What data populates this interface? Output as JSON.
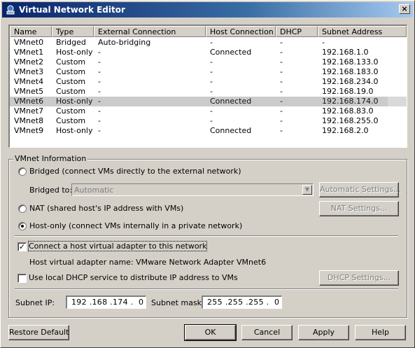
{
  "window": {
    "title": "Virtual Network Editor",
    "close_glyph": "×"
  },
  "list": {
    "columns": [
      "Name",
      "Type",
      "External Connection",
      "Host Connection",
      "DHCP",
      "Subnet Address"
    ],
    "rows": [
      {
        "name": "VMnet0",
        "type": "Bridged",
        "external": "Auto-bridging",
        "host": "-",
        "dhcp": "-",
        "subnet": "-"
      },
      {
        "name": "VMnet1",
        "type": "Host-only",
        "external": "-",
        "host": "Connected",
        "dhcp": "-",
        "subnet": "192.168.1.0"
      },
      {
        "name": "VMnet2",
        "type": "Custom",
        "external": "-",
        "host": "-",
        "dhcp": "-",
        "subnet": "192.168.133.0"
      },
      {
        "name": "VMnet3",
        "type": "Custom",
        "external": "-",
        "host": "-",
        "dhcp": "-",
        "subnet": "192.168.183.0"
      },
      {
        "name": "VMnet4",
        "type": "Custom",
        "external": "-",
        "host": "-",
        "dhcp": "-",
        "subnet": "192.168.234.0"
      },
      {
        "name": "VMnet5",
        "type": "Custom",
        "external": "-",
        "host": "-",
        "dhcp": "-",
        "subnet": "192.168.19.0"
      },
      {
        "name": "VMnet6",
        "type": "Host-only",
        "external": "-",
        "host": "Connected",
        "dhcp": "-",
        "subnet": "192.168.174.0"
      },
      {
        "name": "VMnet7",
        "type": "Custom",
        "external": "-",
        "host": "-",
        "dhcp": "-",
        "subnet": "192.168.83.0"
      },
      {
        "name": "VMnet8",
        "type": "Custom",
        "external": "-",
        "host": "-",
        "dhcp": "-",
        "subnet": "192.168.255.0"
      },
      {
        "name": "VMnet9",
        "type": "Host-only",
        "external": "-",
        "host": "Connected",
        "dhcp": "-",
        "subnet": "192.168.2.0"
      }
    ],
    "selected_index": 6
  },
  "info": {
    "group_label": "VMnet Information",
    "bridged_label": "Bridged (connect VMs directly to the external network)",
    "bridged_to_label": "Bridged to:",
    "bridged_to_value": "Automatic",
    "automatic_settings_button": "Automatic Settings...",
    "nat_label": "NAT (shared host's IP address with VMs)",
    "nat_settings_button": "NAT Settings...",
    "hostonly_label": "Host-only (connect VMs internally in a private network)",
    "selected_mode": "host-only",
    "connect_adapter_label": "Connect a host virtual adapter to this network",
    "connect_adapter_checked": true,
    "adapter_name_label": "Host virtual adapter name: VMware Network Adapter VMnet6",
    "dhcp_label": "Use local DHCP service to distribute IP address to VMs",
    "dhcp_checked": false,
    "dhcp_settings_button": "DHCP Settings...",
    "subnet_ip_label": "Subnet IP:",
    "subnet_ip_value": "192 .168 .174 .  0",
    "subnet_mask_label": "Subnet mask:",
    "subnet_mask_value": "255 .255 .255 .  0"
  },
  "footer": {
    "restore_default": "Restore Default",
    "ok": "OK",
    "cancel": "Cancel",
    "apply": "Apply",
    "help": "Help"
  }
}
